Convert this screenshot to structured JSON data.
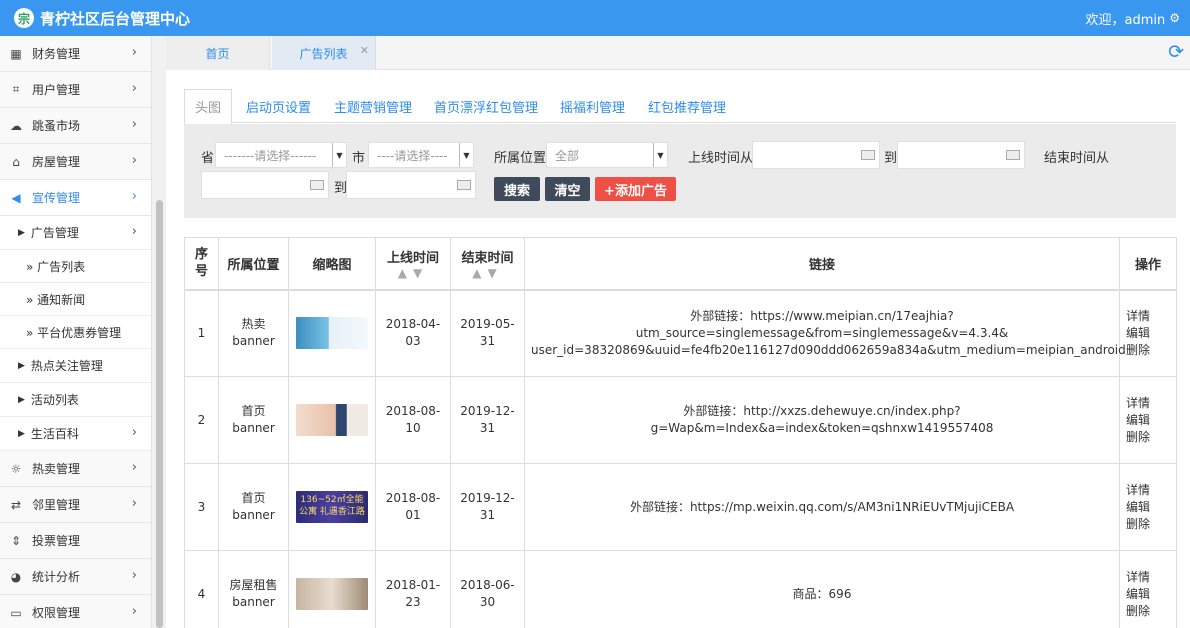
{
  "header": {
    "title": "青柠社区后台管理中心",
    "logo_glyph": "宗",
    "welcome": "欢迎，admin"
  },
  "sidebar": {
    "items": [
      {
        "label": "财务管理",
        "icon": "calculator-icon"
      },
      {
        "label": "用户管理",
        "icon": "crop-icon"
      },
      {
        "label": "跳蚤市场",
        "icon": "cloud-icon"
      },
      {
        "label": "房屋管理",
        "icon": "bank-icon"
      },
      {
        "label": "宣传管理",
        "icon": "megaphone-icon"
      }
    ],
    "sub": [
      {
        "label": "广告管理"
      }
    ],
    "subsub": [
      {
        "label": "» 广告列表"
      },
      {
        "label": "» 通知新闻"
      },
      {
        "label": "» 平台优惠券管理"
      }
    ],
    "sub2": [
      {
        "label": "热点关注管理"
      },
      {
        "label": "活动列表"
      },
      {
        "label": "生活百科"
      }
    ],
    "items2": [
      {
        "label": "热卖管理",
        "icon": "sun-icon"
      },
      {
        "label": "邻里管理",
        "icon": "retweet-icon"
      },
      {
        "label": "投票管理",
        "icon": "sort-icon"
      },
      {
        "label": "统计分析",
        "icon": "pie-icon"
      },
      {
        "label": "权限管理",
        "icon": "laptop-icon"
      }
    ]
  },
  "tabs": {
    "home": "首页",
    "current": "广告列表"
  },
  "subtabs": [
    "头图",
    "启动页设置",
    "主题营销管理",
    "首页漂浮红包管理",
    "摇福利管理",
    "红包推荐管理"
  ],
  "filter": {
    "province_label": "省",
    "province_value": "-------请选择------",
    "city_label": "市",
    "city_value": "----请选择----",
    "position_label": "所属位置",
    "position_value": "全部",
    "online_from_label": "上线时间从",
    "to_label": "到",
    "end_from_label": "结束时间从",
    "to_label_2": "到",
    "search_button": "搜索",
    "clear_button": "清空",
    "add_button": "+添加广告"
  },
  "table": {
    "headers": {
      "seq": "序号",
      "position": "所属位置",
      "thumb": "缩略图",
      "online": "上线时间",
      "end": "结束时间",
      "link": "链接",
      "ops": "操作"
    },
    "sort_arrows": "▲▼",
    "rows": [
      {
        "seq": "1",
        "pos1": "热卖",
        "pos2": "banner",
        "online": "2018-04-03",
        "end": "2019-05-31",
        "link1": "外部链接：https://www.meipian.cn/17eajhia?utm_source=singlemessage&from=singlemessage&v=4.3.4&",
        "link2": "user_id=38320869&uuid=fe4fb20e116127d090ddd062659a834a&utm_medium=meipian_android",
        "op_detail": "详情",
        "op_edit": "编辑",
        "op_delete": "删除"
      },
      {
        "seq": "2",
        "pos1": "首页",
        "pos2": "banner",
        "online": "2018-08-10",
        "end": "2019-12-31",
        "link1": "外部链接：http://xxzs.dehewuye.cn/index.php?g=Wap&m=Index&a=index&token=qshnxw1419557408",
        "link2": "",
        "op_detail": "详情",
        "op_edit": "编辑",
        "op_delete": "删除"
      },
      {
        "seq": "3",
        "pos1": "首页",
        "pos2": "banner",
        "online": "2018-08-01",
        "end": "2019-12-31",
        "link1": "外部链接：https://mp.weixin.qq.com/s/AM3ni1NRiEUvTMjujiCEBA",
        "link2": "",
        "thumb_text": "136~52㎡全能公寓 礼遇香江路",
        "op_detail": "详情",
        "op_edit": "编辑",
        "op_delete": "删除"
      },
      {
        "seq": "4",
        "pos1": "房屋租售",
        "pos2": "banner",
        "online": "2018-01-23",
        "end": "2018-06-30",
        "link1": "商品：696",
        "link2": "",
        "op_detail": "详情",
        "op_edit": "编辑",
        "op_delete": "删除"
      }
    ]
  },
  "colors": {
    "accent": "#3a97f0",
    "link": "#2d8cf0",
    "danger": "#ee5046",
    "dark_button": "#3f4b5b"
  }
}
